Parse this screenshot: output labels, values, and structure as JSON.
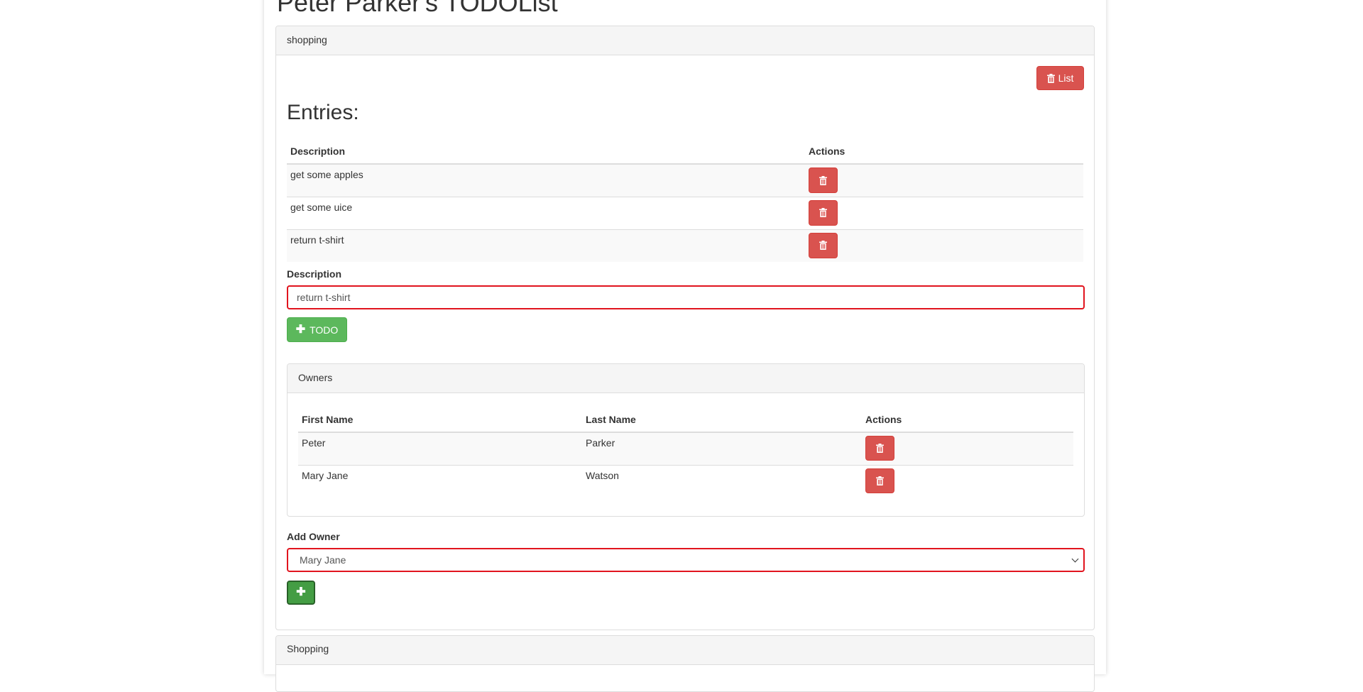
{
  "page": {
    "title": "Peter Parker's TODOList"
  },
  "list_panel": {
    "heading": "shopping",
    "delete_list_label": "List",
    "entries_title": "Entries:",
    "table": {
      "headers": [
        "Description",
        "Actions"
      ],
      "rows": [
        {
          "description": "get some apples"
        },
        {
          "description": "get some uice"
        },
        {
          "description": "return t-shirt"
        }
      ]
    },
    "form": {
      "description_label": "Description",
      "description_value": "return t-shirt",
      "add_todo_label": "TODO"
    }
  },
  "owners_panel": {
    "heading": "Owners",
    "headers": [
      "First Name",
      "Last Name",
      "Actions"
    ],
    "rows": [
      {
        "first_name": "Peter",
        "last_name": "Parker"
      },
      {
        "first_name": "Mary Jane",
        "last_name": "Watson"
      }
    ]
  },
  "add_owner": {
    "label": "Add Owner",
    "selected": "Mary Jane"
  },
  "next_panel": {
    "heading": "Shopping"
  },
  "colors": {
    "danger": "#d9534f",
    "success": "#5cb85c",
    "invalid_border": "#e1141e"
  },
  "icons": {
    "trash": "trash-icon",
    "plus": "plus-icon"
  }
}
